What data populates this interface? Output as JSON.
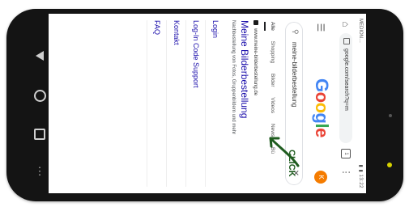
{
  "status": {
    "left": "MEDION…",
    "right": "▮ ▮ 13:22"
  },
  "browser": {
    "url": "google.com/search?q=m",
    "tabs_count": "1"
  },
  "google": {
    "avatar_letter": "K"
  },
  "search": {
    "query": "meine-bilderbestellung",
    "placeholder": ""
  },
  "filters": [
    "Alle",
    "Shopping",
    "Bilder",
    "Videos",
    "News",
    "Bü"
  ],
  "result": {
    "url": "www.meine-bilderbestellung.de",
    "title": "Meine Bilderbestellung",
    "snippet": "Nachbestellung von Fotos, Gruppenbildern und mehr"
  },
  "sitelinks": [
    "Login",
    "Log-In Code Support",
    "Kontakt",
    "FAQ"
  ],
  "annotation": {
    "label": "CLICK",
    "color": "#1f5c1f"
  },
  "colors": {
    "link": "#1a0dab",
    "avatar": "#f57c00"
  }
}
